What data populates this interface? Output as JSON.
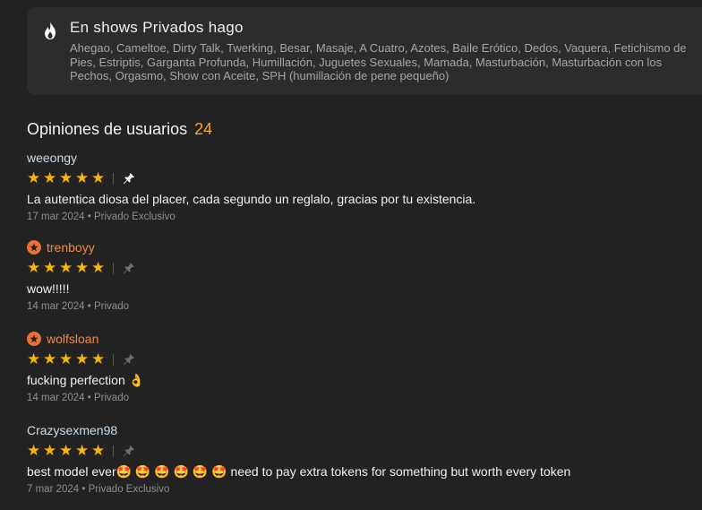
{
  "shows": {
    "title": "En shows Privados hago",
    "icon": "fire-icon",
    "tags": "Ahegao, Cameltoe, Dirty Talk, Twerking, Besar, Masaje, A Cuatro, Azotes, Baile Erótico, Dedos, Vaquera, Fetichismo de Pies, Estriptis, Garganta Profunda, Humillación, Juguetes Sexuales, Mamada, Masturbación, Masturbación con los Pechos, Orgasmo, Show con Aceite, SPH (humillación de pene pequeño)"
  },
  "reviews": {
    "title": "Opiniones de usuarios",
    "count": "24",
    "items": [
      {
        "username": "weeongy",
        "badge": false,
        "rating": 5,
        "pinned": true,
        "comment": "La autentica diosa del placer, cada segundo un reglalo, gracias por tu existencia.",
        "date": "17 mar 2024",
        "type": "Privado Exclusivo"
      },
      {
        "username": "trenboyy",
        "badge": true,
        "rating": 5,
        "pinned": false,
        "comment": "wow!!!!!",
        "date": "14 mar 2024",
        "type": "Privado"
      },
      {
        "username": "wolfsloan",
        "badge": true,
        "rating": 5,
        "pinned": false,
        "comment": "fucking perfection 👌",
        "date": "14 mar 2024",
        "type": "Privado"
      },
      {
        "username": "Crazysexmen98",
        "badge": false,
        "rating": 5,
        "pinned": false,
        "comment": "best model ever🤩 🤩 🤩 🤩 🤩 🤩  need to pay extra tokens for something but worth every token",
        "date": "7 mar 2024",
        "type": "Privado Exclusivo"
      }
    ]
  },
  "colors": {
    "background": "#222222",
    "card": "#2c2c2c",
    "accent": "#f5a623",
    "star": "#f5b40e",
    "badge": "#e6713a",
    "username_vip": "#f08a4b",
    "username_regular": "#c9dcea"
  }
}
